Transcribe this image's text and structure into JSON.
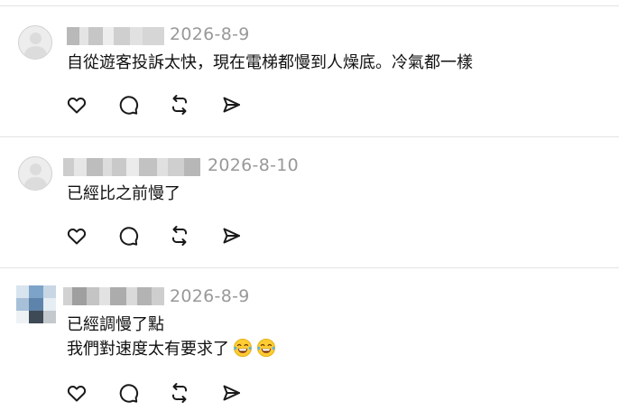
{
  "comments": [
    {
      "author_label": "",
      "timestamp": "2026-8-9",
      "lines": [
        "自從遊客投訴太快，現在電梯都慢到人燥底。冷氣都一樣"
      ],
      "actions": [
        "like-icon",
        "reply-icon",
        "repost-icon",
        "share-icon"
      ]
    },
    {
      "author_label": "",
      "timestamp": "2026-8-10",
      "lines": [
        "已經比之前慢了"
      ],
      "actions": [
        "like-icon",
        "reply-icon",
        "repost-icon",
        "share-icon"
      ]
    },
    {
      "author_label": "",
      "timestamp": "2026-8-9",
      "lines": [
        "已經調慢了點",
        "我們對速度太有要求了"
      ],
      "emoji_after_last_line": [
        "face-with-tears-of-joy",
        "face-with-tears-of-joy"
      ],
      "actions": [
        "like-icon",
        "reply-icon",
        "repost-icon",
        "share-icon"
      ]
    }
  ],
  "colors": {
    "timestamp": "#999999",
    "divider": "#e3e3e3",
    "icon": "#1a1a1a"
  }
}
